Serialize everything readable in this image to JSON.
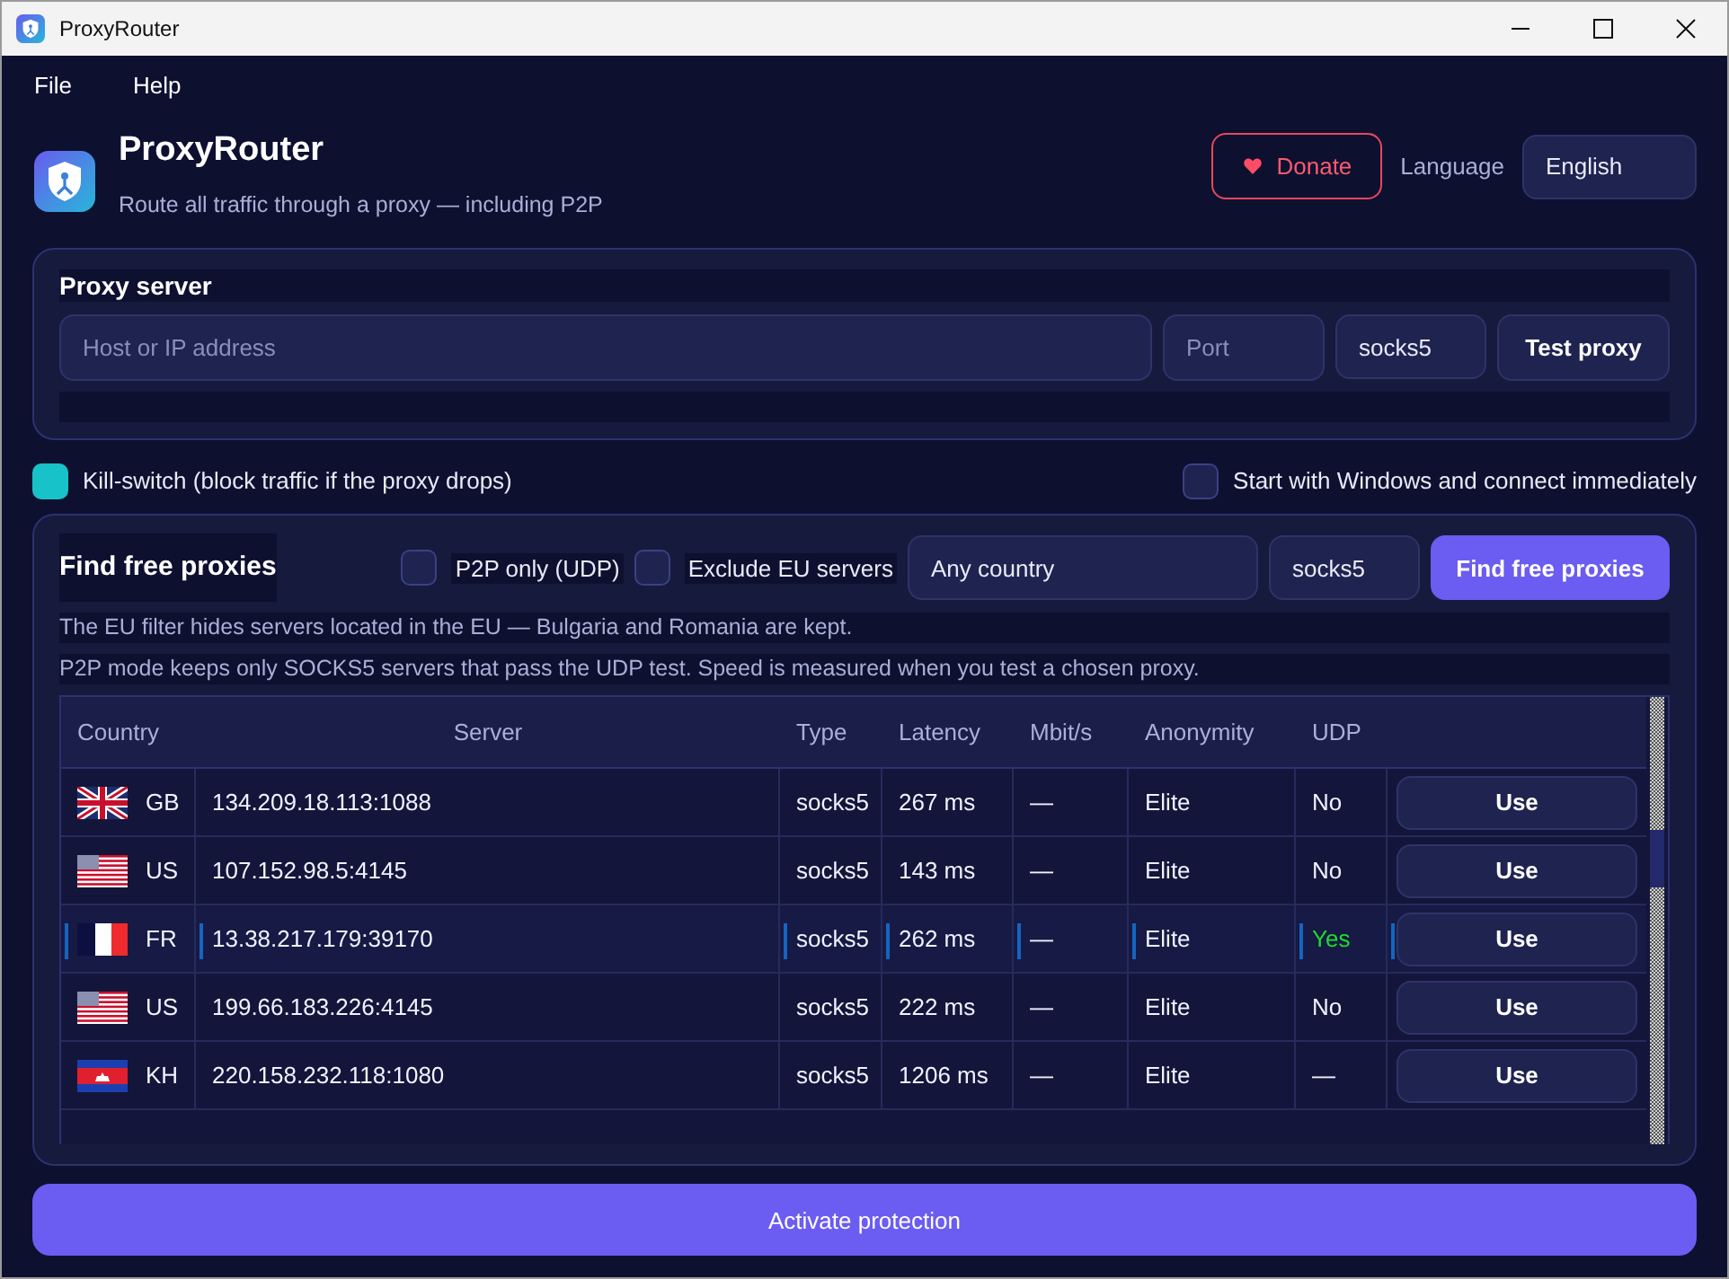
{
  "window": {
    "title": "ProxyRouter"
  },
  "menu": [
    "File",
    "Help"
  ],
  "header": {
    "app_name": "ProxyRouter",
    "tagline": "Route all traffic through a proxy — including P2P",
    "donate": "Donate",
    "language_label": "Language",
    "language": "English"
  },
  "proxy_server": {
    "title": "Proxy server",
    "host_placeholder": "Host or IP address",
    "port_placeholder": "Port",
    "protocol": "socks5",
    "test_button": "Test proxy"
  },
  "options": [
    {
      "label": "Kill-switch (block traffic if the proxy drops)",
      "checked": true
    },
    {
      "label": "Start with Windows and connect immediately",
      "checked": false
    }
  ],
  "finder": {
    "title": "Find free proxies",
    "filters": [
      {
        "label": "P2P only (UDP)",
        "checked": false
      },
      {
        "label": "Exclude EU servers",
        "checked": false
      }
    ],
    "country": "Any country",
    "protocol": "socks5",
    "search_button": "Find free proxies",
    "notes": [
      "The EU filter hides servers located in the EU — Bulgaria and Romania are kept.",
      "P2P mode keeps only SOCKS5 servers that pass the UDP test. Speed is measured when you test a chosen proxy."
    ],
    "table": {
      "columns": [
        "Country",
        "Server",
        "Type",
        "Latency",
        "Mbit/s",
        "Anonymity",
        "UDP"
      ],
      "rows": [
        {
          "kind": "gb",
          "country": "GB",
          "server": "134.209.18.113:1088",
          "type": "socks5",
          "latency": "267 ms",
          "speed": "—",
          "anonymity": "Elite",
          "udp": "No",
          "udp_ok": false,
          "action": "Use",
          "selected": false
        },
        {
          "kind": "us",
          "country": "US",
          "server": "107.152.98.5:4145",
          "type": "socks5",
          "latency": "143 ms",
          "speed": "—",
          "anonymity": "Elite",
          "udp": "No",
          "udp_ok": false,
          "action": "Use",
          "selected": false
        },
        {
          "kind": "fr",
          "country": "FR",
          "server": "13.38.217.179:39170",
          "type": "socks5",
          "latency": "262 ms",
          "speed": "—",
          "anonymity": "Elite",
          "udp": "Yes",
          "udp_ok": true,
          "action": "Use",
          "selected": true
        },
        {
          "kind": "us",
          "country": "US",
          "server": "199.66.183.226:4145",
          "type": "socks5",
          "latency": "222 ms",
          "speed": "—",
          "anonymity": "Elite",
          "udp": "No",
          "udp_ok": false,
          "action": "Use",
          "selected": false
        },
        {
          "kind": "kh",
          "country": "KH",
          "server": "220.158.232.118:1080",
          "type": "socks5",
          "latency": "1206 ms",
          "speed": "—",
          "anonymity": "Elite",
          "udp": "—",
          "udp_ok": false,
          "action": "Use",
          "selected": false
        }
      ]
    }
  },
  "activate_button": "Activate protection"
}
